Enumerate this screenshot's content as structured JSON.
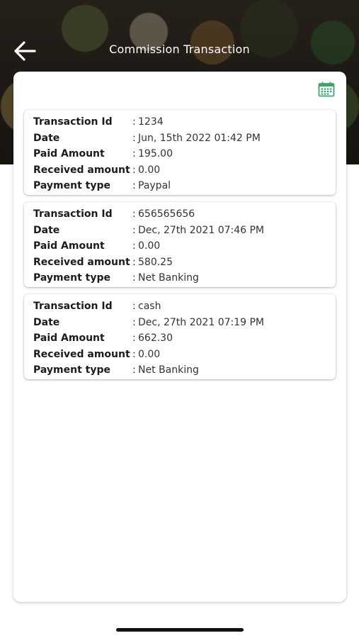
{
  "header": {
    "title": "Commission Transaction",
    "back_icon": "arrow-left-icon"
  },
  "toolbar": {
    "calendar_icon": "calendar-icon",
    "accent_color": "#3fa36b"
  },
  "labels": {
    "transaction_id": "Transaction Id",
    "date": "Date",
    "paid_amount": "Paid Amount",
    "received_amount": "Received amount",
    "payment_type": "Payment type",
    "separator": ":"
  },
  "transactions": [
    {
      "transaction_id": "1234",
      "date": "Jun, 15th 2022 01:42 PM",
      "paid_amount": "195.00",
      "received_amount": "0.00",
      "payment_type": "Paypal"
    },
    {
      "transaction_id": "656565656",
      "date": "Dec, 27th 2021 07:46 PM",
      "paid_amount": "0.00",
      "received_amount": "580.25",
      "payment_type": "Net Banking"
    },
    {
      "transaction_id": "cash",
      "date": "Dec, 27th 2021 07:19 PM",
      "paid_amount": "662.30",
      "received_amount": "0.00",
      "payment_type": "Net Banking"
    }
  ]
}
